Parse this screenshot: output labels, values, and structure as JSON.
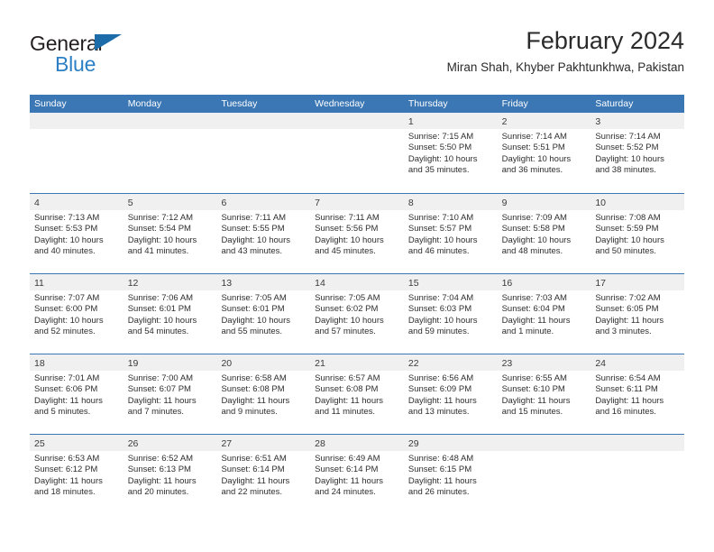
{
  "brand": {
    "line1": "General",
    "line2": "Blue",
    "triangle_icon": "brand-triangle-icon",
    "line1_color": "#231f20",
    "line2_color": "#2b7fc4",
    "triangle_color": "#1b6ca8"
  },
  "header": {
    "title": "February 2024",
    "subtitle": "Miran Shah, Khyber Pakhtunkhwa, Pakistan"
  },
  "colors": {
    "header_bar": "#3b77b5",
    "daynum_band": "#f0f0f0",
    "week_separator": "#3b77b5",
    "text": "#2e2e2e"
  },
  "weekdays": [
    "Sunday",
    "Monday",
    "Tuesday",
    "Wednesday",
    "Thursday",
    "Friday",
    "Saturday"
  ],
  "weeks": [
    [
      {
        "day": "",
        "sunrise": "",
        "sunset": "",
        "daylight1": "",
        "daylight2": ""
      },
      {
        "day": "",
        "sunrise": "",
        "sunset": "",
        "daylight1": "",
        "daylight2": ""
      },
      {
        "day": "",
        "sunrise": "",
        "sunset": "",
        "daylight1": "",
        "daylight2": ""
      },
      {
        "day": "",
        "sunrise": "",
        "sunset": "",
        "daylight1": "",
        "daylight2": ""
      },
      {
        "day": "1",
        "sunrise": "Sunrise: 7:15 AM",
        "sunset": "Sunset: 5:50 PM",
        "daylight1": "Daylight: 10 hours",
        "daylight2": "and 35 minutes."
      },
      {
        "day": "2",
        "sunrise": "Sunrise: 7:14 AM",
        "sunset": "Sunset: 5:51 PM",
        "daylight1": "Daylight: 10 hours",
        "daylight2": "and 36 minutes."
      },
      {
        "day": "3",
        "sunrise": "Sunrise: 7:14 AM",
        "sunset": "Sunset: 5:52 PM",
        "daylight1": "Daylight: 10 hours",
        "daylight2": "and 38 minutes."
      }
    ],
    [
      {
        "day": "4",
        "sunrise": "Sunrise: 7:13 AM",
        "sunset": "Sunset: 5:53 PM",
        "daylight1": "Daylight: 10 hours",
        "daylight2": "and 40 minutes."
      },
      {
        "day": "5",
        "sunrise": "Sunrise: 7:12 AM",
        "sunset": "Sunset: 5:54 PM",
        "daylight1": "Daylight: 10 hours",
        "daylight2": "and 41 minutes."
      },
      {
        "day": "6",
        "sunrise": "Sunrise: 7:11 AM",
        "sunset": "Sunset: 5:55 PM",
        "daylight1": "Daylight: 10 hours",
        "daylight2": "and 43 minutes."
      },
      {
        "day": "7",
        "sunrise": "Sunrise: 7:11 AM",
        "sunset": "Sunset: 5:56 PM",
        "daylight1": "Daylight: 10 hours",
        "daylight2": "and 45 minutes."
      },
      {
        "day": "8",
        "sunrise": "Sunrise: 7:10 AM",
        "sunset": "Sunset: 5:57 PM",
        "daylight1": "Daylight: 10 hours",
        "daylight2": "and 46 minutes."
      },
      {
        "day": "9",
        "sunrise": "Sunrise: 7:09 AM",
        "sunset": "Sunset: 5:58 PM",
        "daylight1": "Daylight: 10 hours",
        "daylight2": "and 48 minutes."
      },
      {
        "day": "10",
        "sunrise": "Sunrise: 7:08 AM",
        "sunset": "Sunset: 5:59 PM",
        "daylight1": "Daylight: 10 hours",
        "daylight2": "and 50 minutes."
      }
    ],
    [
      {
        "day": "11",
        "sunrise": "Sunrise: 7:07 AM",
        "sunset": "Sunset: 6:00 PM",
        "daylight1": "Daylight: 10 hours",
        "daylight2": "and 52 minutes."
      },
      {
        "day": "12",
        "sunrise": "Sunrise: 7:06 AM",
        "sunset": "Sunset: 6:01 PM",
        "daylight1": "Daylight: 10 hours",
        "daylight2": "and 54 minutes."
      },
      {
        "day": "13",
        "sunrise": "Sunrise: 7:05 AM",
        "sunset": "Sunset: 6:01 PM",
        "daylight1": "Daylight: 10 hours",
        "daylight2": "and 55 minutes."
      },
      {
        "day": "14",
        "sunrise": "Sunrise: 7:05 AM",
        "sunset": "Sunset: 6:02 PM",
        "daylight1": "Daylight: 10 hours",
        "daylight2": "and 57 minutes."
      },
      {
        "day": "15",
        "sunrise": "Sunrise: 7:04 AM",
        "sunset": "Sunset: 6:03 PM",
        "daylight1": "Daylight: 10 hours",
        "daylight2": "and 59 minutes."
      },
      {
        "day": "16",
        "sunrise": "Sunrise: 7:03 AM",
        "sunset": "Sunset: 6:04 PM",
        "daylight1": "Daylight: 11 hours",
        "daylight2": "and 1 minute."
      },
      {
        "day": "17",
        "sunrise": "Sunrise: 7:02 AM",
        "sunset": "Sunset: 6:05 PM",
        "daylight1": "Daylight: 11 hours",
        "daylight2": "and 3 minutes."
      }
    ],
    [
      {
        "day": "18",
        "sunrise": "Sunrise: 7:01 AM",
        "sunset": "Sunset: 6:06 PM",
        "daylight1": "Daylight: 11 hours",
        "daylight2": "and 5 minutes."
      },
      {
        "day": "19",
        "sunrise": "Sunrise: 7:00 AM",
        "sunset": "Sunset: 6:07 PM",
        "daylight1": "Daylight: 11 hours",
        "daylight2": "and 7 minutes."
      },
      {
        "day": "20",
        "sunrise": "Sunrise: 6:58 AM",
        "sunset": "Sunset: 6:08 PM",
        "daylight1": "Daylight: 11 hours",
        "daylight2": "and 9 minutes."
      },
      {
        "day": "21",
        "sunrise": "Sunrise: 6:57 AM",
        "sunset": "Sunset: 6:08 PM",
        "daylight1": "Daylight: 11 hours",
        "daylight2": "and 11 minutes."
      },
      {
        "day": "22",
        "sunrise": "Sunrise: 6:56 AM",
        "sunset": "Sunset: 6:09 PM",
        "daylight1": "Daylight: 11 hours",
        "daylight2": "and 13 minutes."
      },
      {
        "day": "23",
        "sunrise": "Sunrise: 6:55 AM",
        "sunset": "Sunset: 6:10 PM",
        "daylight1": "Daylight: 11 hours",
        "daylight2": "and 15 minutes."
      },
      {
        "day": "24",
        "sunrise": "Sunrise: 6:54 AM",
        "sunset": "Sunset: 6:11 PM",
        "daylight1": "Daylight: 11 hours",
        "daylight2": "and 16 minutes."
      }
    ],
    [
      {
        "day": "25",
        "sunrise": "Sunrise: 6:53 AM",
        "sunset": "Sunset: 6:12 PM",
        "daylight1": "Daylight: 11 hours",
        "daylight2": "and 18 minutes."
      },
      {
        "day": "26",
        "sunrise": "Sunrise: 6:52 AM",
        "sunset": "Sunset: 6:13 PM",
        "daylight1": "Daylight: 11 hours",
        "daylight2": "and 20 minutes."
      },
      {
        "day": "27",
        "sunrise": "Sunrise: 6:51 AM",
        "sunset": "Sunset: 6:14 PM",
        "daylight1": "Daylight: 11 hours",
        "daylight2": "and 22 minutes."
      },
      {
        "day": "28",
        "sunrise": "Sunrise: 6:49 AM",
        "sunset": "Sunset: 6:14 PM",
        "daylight1": "Daylight: 11 hours",
        "daylight2": "and 24 minutes."
      },
      {
        "day": "29",
        "sunrise": "Sunrise: 6:48 AM",
        "sunset": "Sunset: 6:15 PM",
        "daylight1": "Daylight: 11 hours",
        "daylight2": "and 26 minutes."
      },
      {
        "day": "",
        "sunrise": "",
        "sunset": "",
        "daylight1": "",
        "daylight2": ""
      },
      {
        "day": "",
        "sunrise": "",
        "sunset": "",
        "daylight1": "",
        "daylight2": ""
      }
    ]
  ]
}
